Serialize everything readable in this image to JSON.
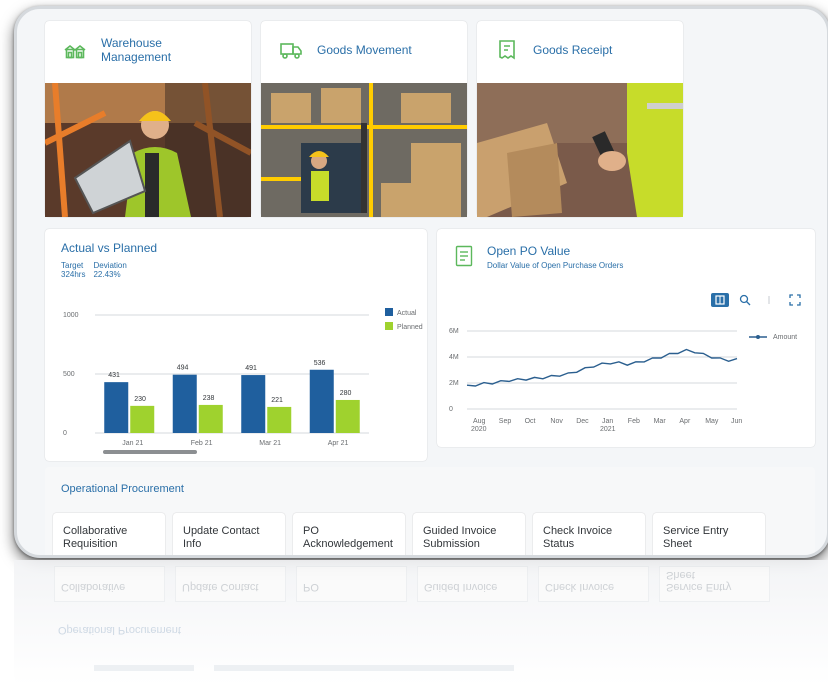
{
  "tiles": [
    {
      "title_line1": "Warehouse",
      "title_line2": "Management",
      "icon": "warehouse-icon"
    },
    {
      "title_line1": "Goods Movement",
      "title_line2": "",
      "icon": "truck-icon"
    },
    {
      "title_line1": "Goods Receipt",
      "title_line2": "",
      "icon": "receipt-icon"
    }
  ],
  "actual_vs_planned": {
    "title": "Actual vs Planned",
    "target_label": "Target",
    "target_value": "324hrs",
    "deviation_label": "Deviation",
    "deviation_value": "22.43%",
    "legend": [
      "Actual",
      "Planned"
    ],
    "colors": {
      "actual": "#1f5f9e",
      "planned": "#9fd22e"
    }
  },
  "open_po": {
    "title": "Open PO Value",
    "subtitle": "Dollar Value of Open Purchase Orders",
    "legend": "Amount",
    "color": "#2b5f8f"
  },
  "procurement": {
    "title": "Operational Procurement",
    "items": [
      {
        "line1": "Collaborative",
        "line2": "Requisition"
      },
      {
        "line1": "Update Contact",
        "line2": "Info"
      },
      {
        "line1": "PO",
        "line2": "Acknowledgement"
      },
      {
        "line1": "Guided Invoice",
        "line2": "Submission"
      },
      {
        "line1": "Check Invoice",
        "line2": "Status"
      },
      {
        "line1": "Service Entry Sheet",
        "line2": ""
      }
    ]
  },
  "chart_data": [
    {
      "type": "bar",
      "title": "Actual vs Planned",
      "categories": [
        "Jan 21",
        "Feb 21",
        "Mar 21",
        "Apr 21"
      ],
      "series": [
        {
          "name": "Actual",
          "values": [
            431,
            494,
            491,
            536
          ]
        },
        {
          "name": "Planned",
          "values": [
            230,
            238,
            221,
            280
          ]
        }
      ],
      "yticks": [
        "0",
        "500",
        "1000"
      ],
      "ylim": [
        0,
        1000
      ],
      "legend": "right"
    },
    {
      "type": "line",
      "title": "Open PO Value",
      "series": [
        {
          "name": "Amount",
          "values": [
            1.75,
            1.85,
            1.95,
            2.0,
            2.1,
            2.2,
            2.25,
            2.3,
            2.35,
            2.4,
            2.5,
            2.6,
            2.7,
            2.9,
            3.1,
            3.3,
            3.45,
            3.55,
            3.55,
            3.45,
            3.55,
            3.7,
            3.85,
            4.0,
            4.2,
            4.35,
            4.5,
            4.4,
            4.2,
            4.0,
            3.85,
            3.75,
            3.8
          ]
        }
      ],
      "xticks": [
        "Aug",
        "Sep",
        "Oct",
        "Nov",
        "Dec",
        "Jan",
        "Feb",
        "Mar",
        "Apr",
        "May",
        "Jun"
      ],
      "xsub": [
        "2020",
        "2021"
      ],
      "yticks": [
        "0",
        "2M",
        "4M",
        "6M"
      ],
      "ylim": [
        0,
        6
      ],
      "legend": "right"
    }
  ]
}
